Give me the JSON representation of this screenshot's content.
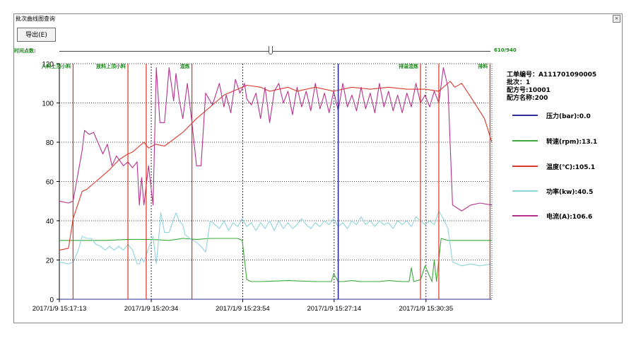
{
  "window": {
    "title": "批次曲线图查询"
  },
  "toolbar": {
    "export_label": "导出(E)"
  },
  "slider": {
    "label": "时间点数:",
    "count": "610/940",
    "position": 0.49
  },
  "info": {
    "work_order": "工单编号：A111701090005",
    "batch": "批次：1",
    "recipe_no": "配方号:10001",
    "recipe_name": "配方名称:200"
  },
  "legend": [
    {
      "label": "压力(bar):0.0",
      "color": "#2d2d9c"
    },
    {
      "label": "转速(rpm):13.1",
      "color": "#3aaa3a"
    },
    {
      "label": "温度(℃):105.1",
      "color": "#d93a2a"
    },
    {
      "label": "功率(kw):40.5",
      "color": "#8fd3de"
    },
    {
      "label": "电流(A):106.6",
      "color": "#b6318c"
    }
  ],
  "chart_data": {
    "type": "line",
    "xlabel": "",
    "ylabel": "",
    "ylim": [
      0,
      120
    ],
    "yticks": [
      0,
      20,
      40,
      60,
      80,
      100,
      120
    ],
    "grid": true,
    "x_tick_labels": [
      "2017/1/9 15:17:13",
      "2017/1/9 15:20:34",
      "2017/1/9 15:23:54",
      "2017/1/9 15:27:14",
      "2017/1/9 15:30:35"
    ],
    "x_tick_times": [
      0,
      201,
      401,
      601,
      802
    ],
    "xlim": [
      0,
      946
    ],
    "phase_markers": [
      {
        "label": "入料上顶小料",
        "t": 30
      },
      {
        "label": "放料上顶小料",
        "t": 150
      },
      {
        "label": "混炼",
        "t": 290
      },
      {
        "label": "排温混炼",
        "t": 790
      },
      {
        "label": "排料",
        "t": 942
      }
    ],
    "other_red_markers": [
      190,
      830
    ],
    "cursor_t": 610,
    "series": [
      {
        "name": "压力(bar)",
        "color": "#2d2d9c",
        "x": [
          0,
          946
        ],
        "values": [
          0,
          0
        ]
      },
      {
        "name": "转速(rpm)",
        "color": "#3aaa3a",
        "x": [
          0,
          100,
          150,
          200,
          240,
          270,
          300,
          330,
          390,
          400,
          410,
          420,
          430,
          440,
          500,
          560,
          595,
          600,
          610,
          620,
          640,
          660,
          700,
          720,
          750,
          765,
          770,
          775,
          790,
          800,
          815,
          820,
          825,
          835,
          850,
          880,
          946
        ],
        "values": [
          30,
          30,
          30.5,
          30.5,
          30,
          31,
          30.5,
          31,
          31,
          30,
          10,
          9,
          9,
          9,
          9.5,
          9,
          9,
          13,
          9,
          9,
          9.5,
          9,
          9,
          9.5,
          9,
          9,
          16,
          9,
          10,
          17,
          9,
          20,
          9,
          31,
          30,
          30,
          30
        ]
      },
      {
        "name": "温度(℃)",
        "color": "#d93a2a",
        "x": [
          0,
          20,
          30,
          50,
          60,
          80,
          110,
          130,
          150,
          160,
          185,
          195,
          210,
          230,
          270,
          300,
          340,
          360,
          390,
          410,
          440,
          460,
          500,
          520,
          560,
          600,
          640,
          680,
          720,
          760,
          800,
          830,
          845,
          855,
          865,
          880,
          900,
          930,
          946
        ],
        "values": [
          25,
          26,
          41,
          55,
          56,
          60,
          66,
          71,
          74,
          75,
          80,
          77,
          79,
          78,
          85,
          92,
          100,
          104,
          107,
          109,
          108,
          106,
          108,
          106,
          108,
          106,
          108,
          107,
          108,
          107,
          107,
          106,
          109,
          111,
          108,
          110,
          103,
          92,
          80
        ]
      },
      {
        "name": "功率(kw)",
        "color": "#8fd3de",
        "x": [
          0,
          20,
          30,
          40,
          50,
          60,
          70,
          80,
          90,
          100,
          110,
          120,
          130,
          140,
          150,
          160,
          170,
          175,
          180,
          185,
          195,
          205,
          212,
          215,
          222,
          230,
          240,
          255,
          262,
          270,
          275,
          285,
          300,
          310,
          320,
          330,
          340,
          350,
          360,
          370,
          380,
          390,
          400,
          410,
          420,
          430,
          440,
          450,
          460,
          470,
          480,
          490,
          500,
          510,
          520,
          530,
          540,
          550,
          560,
          570,
          580,
          590,
          600,
          610,
          620,
          630,
          640,
          650,
          660,
          670,
          680,
          690,
          700,
          710,
          720,
          730,
          740,
          750,
          760,
          770,
          780,
          790,
          800,
          810,
          820,
          830,
          840,
          850,
          860,
          880,
          900,
          920,
          946
        ],
        "values": [
          19,
          18,
          19,
          24,
          32,
          31,
          31,
          28,
          27,
          25,
          27,
          25,
          27,
          25,
          28,
          25,
          18,
          18,
          21,
          19,
          26,
          32,
          18,
          25,
          44,
          34,
          34,
          44,
          40,
          38,
          33,
          31,
          29,
          27,
          24,
          40,
          38,
          36,
          40,
          35,
          39,
          37,
          41,
          37,
          39,
          35,
          39,
          36,
          40,
          35,
          40,
          36,
          39,
          36,
          38,
          41,
          38,
          36,
          39,
          37,
          40,
          38,
          41,
          37,
          39,
          36,
          40,
          38,
          42,
          38,
          40,
          37,
          40,
          38,
          39,
          36,
          40,
          38,
          40,
          37,
          42,
          40,
          38,
          40,
          38,
          45,
          41,
          36,
          19,
          17,
          18,
          17,
          18
        ]
      },
      {
        "name": "电流(A)",
        "color": "#b6318c",
        "x": [
          0,
          20,
          30,
          50,
          55,
          65,
          75,
          95,
          105,
          115,
          125,
          140,
          150,
          160,
          170,
          175,
          180,
          185,
          195,
          205,
          212,
          220,
          230,
          240,
          250,
          255,
          262,
          270,
          280,
          290,
          300,
          310,
          320,
          335,
          350,
          360,
          365,
          375,
          385,
          395,
          405,
          410,
          420,
          430,
          440,
          450,
          460,
          470,
          480,
          490,
          500,
          510,
          520,
          530,
          540,
          550,
          560,
          570,
          580,
          590,
          600,
          610,
          620,
          630,
          640,
          650,
          660,
          670,
          680,
          690,
          700,
          710,
          720,
          730,
          740,
          750,
          760,
          770,
          780,
          790,
          800,
          810,
          820,
          830,
          840,
          850,
          860,
          880,
          900,
          920,
          946
        ],
        "values": [
          50,
          49,
          50,
          76,
          86,
          84,
          85,
          74,
          79,
          68,
          73,
          68,
          70,
          67,
          70,
          48,
          62,
          48,
          68,
          48,
          118,
          90,
          90,
          118,
          101,
          115,
          102,
          92,
          110,
          90,
          68,
          68,
          105,
          99,
          110,
          98,
          104,
          95,
          112,
          105,
          110,
          102,
          99,
          105,
          92,
          108,
          90,
          106,
          110,
          100,
          106,
          94,
          108,
          98,
          106,
          96,
          110,
          97,
          105,
          95,
          106,
          96,
          110,
          98,
          104,
          96,
          108,
          97,
          105,
          95,
          110,
          98,
          106,
          96,
          104,
          95,
          105,
          98,
          110,
          100,
          104,
          98,
          106,
          100,
          118,
          108,
          48,
          45,
          48,
          49,
          48
        ]
      }
    ]
  }
}
